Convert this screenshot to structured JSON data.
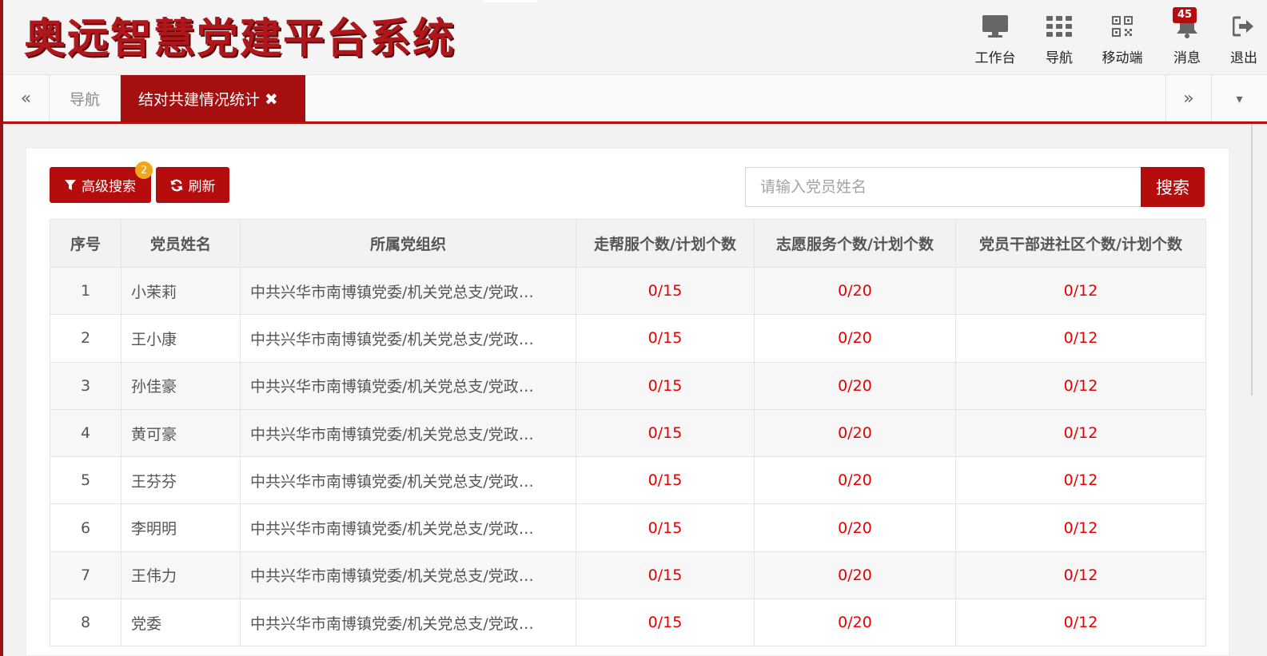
{
  "app": {
    "title": "奥远智慧党建平台系统"
  },
  "top_nav": [
    {
      "id": "workbench",
      "label": "工作台",
      "icon": "monitor-icon"
    },
    {
      "id": "nav",
      "label": "导航",
      "icon": "grid-icon"
    },
    {
      "id": "mobile",
      "label": "移动端",
      "icon": "qrcode-icon"
    },
    {
      "id": "messages",
      "label": "消息",
      "icon": "bell-icon",
      "badge": "45"
    },
    {
      "id": "logout",
      "label": "退出",
      "icon": "logout-icon"
    }
  ],
  "tabs": {
    "prev_icon": "«",
    "next_icon": "»",
    "dropdown_icon": "▾",
    "items": [
      {
        "label": "导航",
        "active": false
      },
      {
        "label": "结对共建情况统计",
        "active": true,
        "close": "✖"
      }
    ]
  },
  "toolbar": {
    "advanced_search_label": "高级搜索",
    "advanced_search_badge": "2",
    "refresh_label": "刷新",
    "search_placeholder": "请输入党员姓名",
    "search_value": "",
    "search_button_label": "搜索"
  },
  "table": {
    "headers": [
      "序号",
      "党员姓名",
      "所属党组织",
      "走帮服个数/计划个数",
      "志愿服务个数/计划个数",
      "党员干部进社区个数/计划个数"
    ],
    "rows": [
      [
        "1",
        "小茉莉",
        "中共兴华市南博镇党委/机关党总支/党政…",
        "0/15",
        "0/20",
        "0/12"
      ],
      [
        "2",
        "王小康",
        "中共兴华市南博镇党委/机关党总支/党政…",
        "0/15",
        "0/20",
        "0/12"
      ],
      [
        "3",
        "孙佳豪",
        "中共兴华市南博镇党委/机关党总支/党政…",
        "0/15",
        "0/20",
        "0/12"
      ],
      [
        "4",
        "黄可豪",
        "中共兴华市南博镇党委/机关党总支/党政…",
        "0/15",
        "0/20",
        "0/12"
      ],
      [
        "5",
        "王芬芬",
        "中共兴华市南博镇党委/机关党总支/党政…",
        "0/15",
        "0/20",
        "0/12"
      ],
      [
        "6",
        "李明明",
        "中共兴华市南博镇党委/机关党总支/党政…",
        "0/15",
        "0/20",
        "0/12"
      ],
      [
        "7",
        "王伟力",
        "中共兴华市南博镇党委/机关党总支/党政…",
        "0/15",
        "0/20",
        "0/12"
      ],
      [
        "8",
        "党委",
        "中共兴华市南博镇党委/机关党总支/党政…",
        "0/15",
        "0/20",
        "0/12"
      ]
    ]
  },
  "colors": {
    "brand_red": "#b50d0d",
    "value_red": "#e60000",
    "badge_orange": "#f0a81a"
  }
}
